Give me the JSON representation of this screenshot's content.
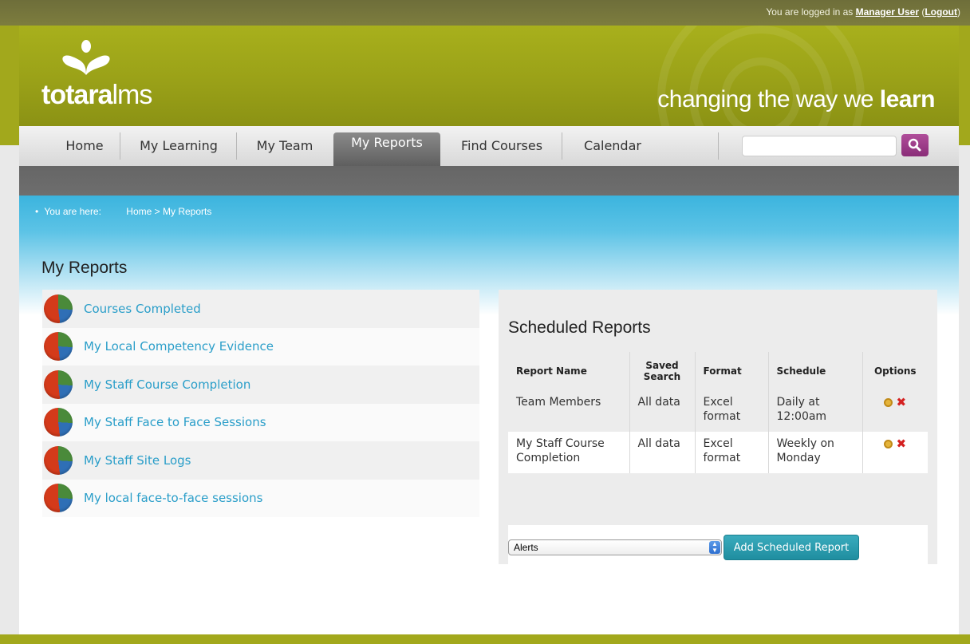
{
  "login": {
    "prefix": "You are logged in as ",
    "user": "Manager User",
    "logout": "Logout"
  },
  "brand": {
    "logo_bold": "totara",
    "logo_light": "lms",
    "tagline_light": "changing the way we ",
    "tagline_bold": "learn",
    "color": "#a2a81c"
  },
  "nav": {
    "items": [
      {
        "label": "Home"
      },
      {
        "label": "My Learning"
      },
      {
        "label": "My Team"
      },
      {
        "label": "My Reports",
        "active": true
      },
      {
        "label": "Find Courses"
      },
      {
        "label": "Calendar"
      }
    ],
    "search_placeholder": ""
  },
  "breadcrumb": {
    "label": "You are here:",
    "home": "Home",
    "separator": ">",
    "current": "My Reports"
  },
  "page": {
    "title": "My Reports"
  },
  "reports": [
    "Courses Completed",
    "My Local Competency Evidence",
    "My Staff Course Completion",
    "My Staff Face to Face Sessions",
    "My Staff Site Logs",
    "My local face-to-face sessions"
  ],
  "scheduled": {
    "title": "Scheduled Reports",
    "columns": [
      "Report Name",
      "Saved Search",
      "Format",
      "Schedule",
      "Options"
    ],
    "rows": [
      {
        "name": "Team Members",
        "saved_search": "All data",
        "format": "Excel format",
        "schedule": "Daily at 12:00am"
      },
      {
        "name": "My Staff Course Completion",
        "saved_search": "All data",
        "format": "Excel format",
        "schedule": "Weekly on Monday"
      }
    ],
    "select_value": "Alerts",
    "add_button": "Add Scheduled Report"
  }
}
